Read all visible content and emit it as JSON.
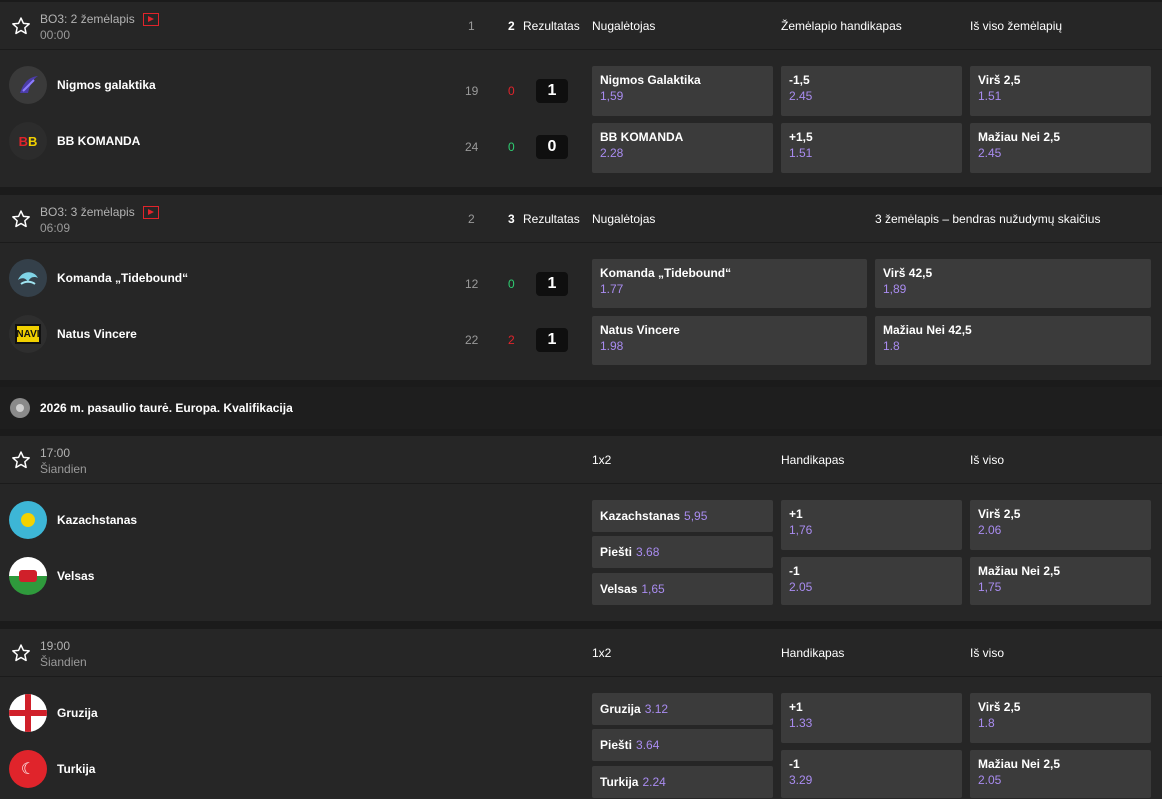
{
  "matches": [
    {
      "title": "BO3: 2 žemėlapis",
      "sub": "00:00",
      "cols": {
        "c1": "1",
        "c2": "2",
        "res": "Rezultatas",
        "m1": "Nugalėtojas",
        "m2": "Žemėlapio handikapas",
        "m3": "Iš viso žemėlapių"
      },
      "teams": [
        {
          "name": "Nigmos galaktika",
          "n1": "19",
          "n2": "0",
          "score": "1"
        },
        {
          "name": "BB KOMANDA",
          "n1": "24",
          "n2": "0",
          "score": "0"
        }
      ],
      "odds": [
        [
          {
            "l": "Nigmos Galaktika",
            "v": "1,59"
          },
          {
            "l": "-1,5",
            "v": "2.45"
          },
          {
            "l": "Virš 2,5",
            "v": "1.51"
          }
        ],
        [
          {
            "l": "BB KOMANDA",
            "v": "2.28"
          },
          {
            "l": "+1,5",
            "v": "1.51"
          },
          {
            "l": "Mažiau Nei 2,5",
            "v": "2.45"
          }
        ]
      ]
    },
    {
      "title": "BO3: 3 žemėlapis",
      "sub": "06:09",
      "cols": {
        "c1": "2",
        "c2": "3",
        "res": "Rezultatas",
        "m1": "Nugalėtojas",
        "m2": "3 žemėlapis – bendras nužudymų skaičius"
      },
      "teams": [
        {
          "name": "Komanda „Tidebound“",
          "n1": "12",
          "n2": "0",
          "score": "1"
        },
        {
          "name": "Natus Vincere",
          "n1": "22",
          "n2": "2",
          "score": "1"
        }
      ],
      "odds": [
        [
          {
            "l": "Komanda „Tidebound“",
            "v": "1.77"
          },
          {
            "l": "Virš 42,5",
            "v": "1,89"
          }
        ],
        [
          {
            "l": "Natus Vincere",
            "v": "1.98"
          },
          {
            "l": "Mažiau Nei 42,5",
            "v": "1.8"
          }
        ]
      ]
    }
  ],
  "section": {
    "title": "2026 m. pasaulio taurė. Europa. Kvalifikacija",
    "icon": "soccer-ball-icon"
  },
  "fixtures": [
    {
      "time": "17:00",
      "day": "Šiandien",
      "cols": {
        "m1": "1x2",
        "m2": "Handikapas",
        "m3": "Iš viso"
      },
      "teams": [
        {
          "name": "Kazachstanas"
        },
        {
          "name": "Velsas"
        }
      ],
      "x12": [
        {
          "l": "Kazachstanas",
          "v": "5,95"
        },
        {
          "l": "Piešti",
          "v": "3.68"
        },
        {
          "l": "Velsas",
          "v": "1,65"
        }
      ],
      "hcp": [
        {
          "l": "+1",
          "v": "1,76"
        },
        {
          "l": "-1",
          "v": "2.05"
        }
      ],
      "tot": [
        {
          "l": "Virš 2,5",
          "v": "2.06"
        },
        {
          "l": "Mažiau Nei 2,5",
          "v": "1,75"
        }
      ]
    },
    {
      "time": "19:00",
      "day": "Šiandien",
      "cols": {
        "m1": "1x2",
        "m2": "Handikapas",
        "m3": "Iš viso"
      },
      "teams": [
        {
          "name": "Gruzija"
        },
        {
          "name": "Turkija"
        }
      ],
      "x12": [
        {
          "l": "Gruzija",
          "v": "3.12"
        },
        {
          "l": "Piešti",
          "v": "3.64"
        },
        {
          "l": "Turkija",
          "v": "2.24"
        }
      ],
      "hcp": [
        {
          "l": "+1",
          "v": "1.33"
        },
        {
          "l": "-1",
          "v": "3.29"
        }
      ],
      "tot": [
        {
          "l": "Virš 2,5",
          "v": "1.8"
        },
        {
          "l": "Mažiau Nei 2,5",
          "v": "2.05"
        }
      ]
    }
  ],
  "colors": {
    "accent": "#a98cf0",
    "live": "#e0242b",
    "win": "#2ecc71"
  }
}
